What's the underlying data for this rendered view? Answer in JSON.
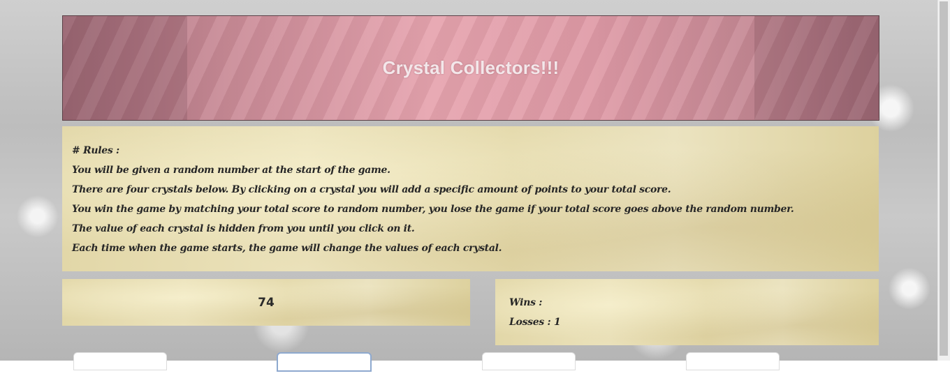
{
  "header": {
    "title": "Crystal Collectors!!!"
  },
  "rules": {
    "heading": "# Rules :",
    "lines": [
      "You will be given a random number at the start of the game.",
      "There are four crystals below. By clicking on a crystal you will add a specific amount of points to your total score.",
      "You win the game by matching your total score to random number, you lose the game if your total score goes above the random number.",
      "The value of each crystal is hidden from you until you click on it.",
      "Each time when the game starts, the game will change the values of each crystal."
    ]
  },
  "game": {
    "target_number": "74",
    "wins_label": "Wins :",
    "losses_label": "Losses : 1"
  },
  "crystals": [
    {
      "name": "crystal-1"
    },
    {
      "name": "crystal-2"
    },
    {
      "name": "crystal-3"
    },
    {
      "name": "crystal-4"
    }
  ],
  "colors": {
    "header_pink": "#df9aa6",
    "parchment": "#e6dcaf",
    "text": "#262626"
  }
}
